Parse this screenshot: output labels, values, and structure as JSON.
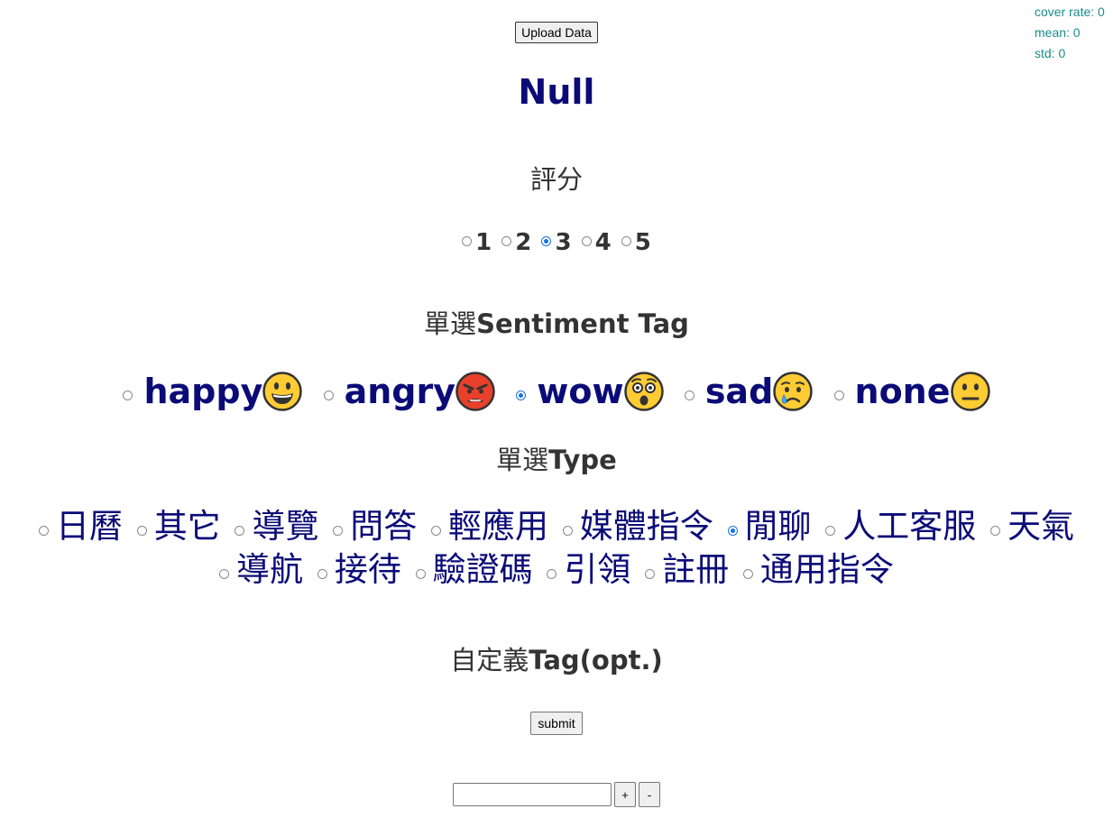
{
  "stats": {
    "cover_rate": "cover rate: 0",
    "mean": "mean: 0",
    "std": "std: 0"
  },
  "upload_button": "Upload Data",
  "title": "Null",
  "score": {
    "heading": "評分",
    "options": [
      "1",
      "2",
      "3",
      "4",
      "5"
    ],
    "selected": "3"
  },
  "sentiment": {
    "heading_prefix": "單選",
    "heading_bold": "Sentiment Tag",
    "options": [
      {
        "label": "happy",
        "icon": "grinning-face-icon"
      },
      {
        "label": "angry",
        "icon": "angry-face-icon"
      },
      {
        "label": "wow",
        "icon": "astonished-face-icon"
      },
      {
        "label": "sad",
        "icon": "crying-face-icon"
      },
      {
        "label": "none",
        "icon": "neutral-face-icon"
      }
    ],
    "selected": "wow"
  },
  "type": {
    "heading_prefix": "單選",
    "heading_bold": "Type",
    "options_row1": [
      "日曆",
      "其它",
      "導覽",
      "問答",
      "輕應用",
      "媒體指令",
      "閒聊",
      "人工客服",
      "天氣"
    ],
    "options_row2": [
      "導航",
      "接待",
      "驗證碼",
      "引領",
      "註冊",
      "通用指令"
    ],
    "selected": "閒聊"
  },
  "custom_tag": {
    "heading_prefix": "自定義",
    "heading_bold": "Tag(opt.)"
  },
  "submit_button": "submit",
  "tag_input": {
    "value": "",
    "placeholder": ""
  },
  "plus_button": "+",
  "minus_button": "-",
  "colors": {
    "title": "#0b0b78",
    "stats": "#1a8b8b",
    "radio_checked": "#1a73e8"
  }
}
